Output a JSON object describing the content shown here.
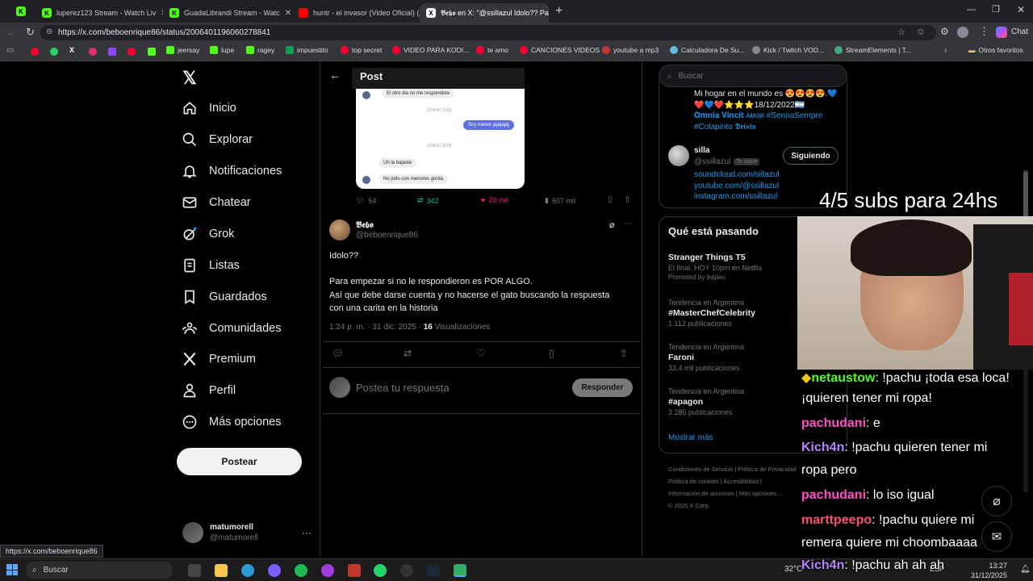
{
  "browser": {
    "tabs": [
      {
        "label": "luperez123 Stream - Watch Liv",
        "color": "#53fc18"
      },
      {
        "label": "GuadaLibrandi Stream - Watc",
        "color": "#53fc18"
      },
      {
        "label": "huntr - el invasor (Video Oficial) (A",
        "color": "#ff0000"
      },
      {
        "label": "𝕭𝖊𝖇𝖔 en X: \"@ssillazul Idolo?? Pa",
        "color": "#ffffff"
      }
    ],
    "url": "https://x.com/beboenrique86/status/2006401196060278841",
    "chat_label": "Chat",
    "bookmarks": [
      "jeersay",
      "lupe",
      "ragey",
      "impuestito",
      "top secret",
      "VIDEO PARA KODI...",
      "te amo",
      "CANCIONES VIDEOS",
      "youtube a mp3",
      "Calculadora De Su...",
      "Kick / Twitch VOD...",
      "StreamElements | T..."
    ],
    "other_bookmarks": "Otros favoritos"
  },
  "nav": {
    "items": [
      "Inicio",
      "Explorar",
      "Notificaciones",
      "Chatear",
      "Grok",
      "Listas",
      "Guardados",
      "Comunidades",
      "Premium",
      "Perfil",
      "Más opciones"
    ],
    "post_button": "Postear",
    "account_name": "matumorell",
    "account_handle": "@matumorell"
  },
  "post": {
    "header": "Post",
    "image_texts": [
      "El otro dia no me respondiste",
      "13 AGO 2019",
      "Soy menor jajajajaj",
      "13 AGO 2019",
      "Uh la bajaste",
      "No jodo con menores gorda"
    ],
    "quoted_stats": {
      "replies": "54",
      "reposts": "342",
      "likes": "20 mil",
      "views": "607 mil"
    },
    "author_name": "𝕭𝖊𝖇𝖔",
    "author_handle": "@beboenrique86",
    "text_lines": [
      "Idolo??",
      "",
      "Para empezar si no le respondieron es POR ALGO.",
      "Así que debe darse cuenta y no hacerse el gato buscando la respuesta",
      "con una carita en la historia"
    ],
    "timestamp": "1:24 p. m. · 31 dic. 2025 · ",
    "views_count": "16",
    "views_label": " Visualizaciones",
    "reply_placeholder": "Postea tu respuesta",
    "reply_button": "Responder"
  },
  "right": {
    "search_placeholder": "Buscar",
    "bio_lines": [
      "Mi hogar en el mundo es 😍😍😍😍.💙",
      "❤️💙❤️⭐⭐⭐18/12/2022🇦🇷",
      "𝐎𝐦𝐧𝐢𝐚 𝐕𝐢𝐧𝐜𝐢𝐭 ᴀᴍᴏʀ #SennaSempre",
      "#Colapinto 𝕯𝖊𝖎𝖘𝖙𝖆"
    ],
    "follow": {
      "name": "silla",
      "handle": "@ssillazul",
      "badge": "Te sigue",
      "button": "Siguiendo",
      "links": [
        "soundcloud.com/sillazul",
        "youtube.com/@ssillazul",
        "instagram.com/ssillazul"
      ]
    },
    "trends_title": "Qué está pasando",
    "trends": [
      {
        "top": "",
        "title": "Stranger Things T5",
        "sub": "El final. HOY 10pm en Netflix",
        "extra": "Promoted by ʇsᴉlɟʇǝu"
      },
      {
        "top": "Tendencia en Argentina",
        "title": "#MasterChefCelebrity",
        "sub": "1.112 publicaciones",
        "extra": ""
      },
      {
        "top": "Tendencia en Argentina",
        "title": "Faroni",
        "sub": "33,4 mil publicaciones",
        "extra": ""
      },
      {
        "top": "Tendencia en Argentina",
        "title": "#apagon",
        "sub": "3.285 publicaciones",
        "extra": ""
      }
    ],
    "show_more": "Mostrar más",
    "footer": [
      "Condiciones de Servicio | Política de Privacidad",
      "Política de cookies | Accesibilidad |",
      "Información de anuncios | Más opciones ...",
      "© 2025 X Corp."
    ]
  },
  "overlay": {
    "subs": "4/5 subs para 24hs",
    "chat": [
      {
        "user": "netaustow",
        "color": "#53fc18",
        "msg": ": !pachu ¡toda esa loca!"
      },
      {
        "user": "",
        "color": "#fff",
        "msg": "¡quieren tener mi ropa!"
      },
      {
        "user": "pachudani",
        "color": "#ff4fc8",
        "msg": ": e"
      },
      {
        "user": "Kich4n",
        "color": "#b784ff",
        "msg": ": !pachu quieren tener mi"
      },
      {
        "user": "",
        "color": "#fff",
        "msg": "ropa pero"
      },
      {
        "user": "pachudani",
        "color": "#ff4fc8",
        "msg": ": lo iso igual"
      },
      {
        "user": "marttpeepo",
        "color": "#ff4f6e",
        "msg": ": !pachu quiere mi"
      },
      {
        "user": "",
        "color": "#fff",
        "msg": "remera quiere mi choombaaaa"
      },
      {
        "user": "Kich4n",
        "color": "#b784ff",
        "msg": ": !pachu ah ah ah"
      }
    ]
  },
  "status_url": "https://x.com/beboenrique86",
  "taskbar": {
    "search": "Buscar",
    "temp": "32°C",
    "lang": "ESP",
    "time": "13:27",
    "date": "31/12/2025"
  }
}
